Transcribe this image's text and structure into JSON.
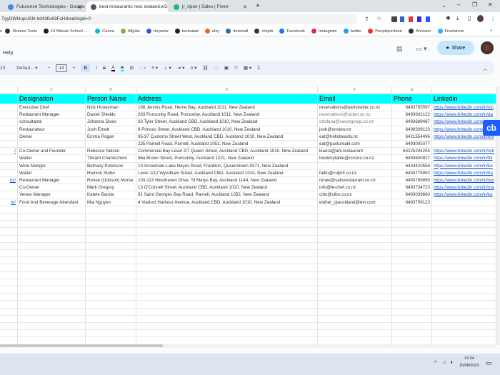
{
  "browser": {
    "tabs": [
      {
        "title": "Futurense Technologies - Google",
        "favicon_color": "#4285f4"
      },
      {
        "title": "best restaurants new zealand - G",
        "favicon_color": "#555555",
        "active": true
      },
      {
        "title": "jr_ripon | Sales | Fiverr",
        "favicon_color": "#1dbf73"
      }
    ],
    "new_tab": "+",
    "url": "TgyDWNupUSN-lrd43fix83FcH8/edit#gid=0",
    "bookmarks": [
      {
        "label": "Shanes Tools",
        "color": "#333"
      },
      {
        "label": "10 Minute School -...",
        "color": "#222"
      },
      {
        "label": "Canva",
        "color": "#00c4cc"
      },
      {
        "label": "Alljobs",
        "color": "#7cb342"
      },
      {
        "label": "tinywow",
        "color": "#3b5bdb"
      },
      {
        "label": "toolsalad",
        "color": "#222"
      },
      {
        "label": "etsy",
        "color": "#f1641e"
      },
      {
        "label": "timewall",
        "color": "#2b6cb0"
      },
      {
        "label": "clixjob",
        "color": "#333"
      },
      {
        "label": "Facebook",
        "color": "#1877f2"
      },
      {
        "label": "Instagram",
        "color": "#d62976"
      },
      {
        "label": "twitter",
        "color": "#1da1f2"
      },
      {
        "label": "Peopleperhour",
        "color": "#e53935"
      },
      {
        "label": "Amzaon",
        "color": "#333"
      },
      {
        "label": "Freelancer",
        "color": "#29b2fe"
      }
    ],
    "more": "»"
  },
  "sheets": {
    "menu_help": "Help",
    "share_label": "Share",
    "toolbar": {
      "zoom_partial": "23",
      "font": "Defaul...",
      "font_size": "14",
      "minus": "−",
      "plus": "+",
      "bold": "B",
      "italic": "I",
      "strike": "S",
      "text_color": "A",
      "sigma": "Σ",
      "link": "⛓"
    },
    "columns": [
      "C",
      "D",
      "E",
      "F",
      "G"
    ],
    "headers": [
      "Designation",
      "Person Name",
      "Address",
      "Email",
      "Phone",
      "Linkedin"
    ],
    "header_bg": "#00ffff",
    "rows": [
      {
        "b": "",
        "designation": "Executive Chef",
        "name": "Nick Honeyman",
        "address": "166 Jervois Road, Herne Bay, Auckland 1011, New Zealand",
        "email": "reservations@parisbutter.co.nz",
        "phone": "6493765597",
        "linkedin": "https://www.linkedin.com/in/nic"
      },
      {
        "b": "",
        "designation": "Restaurant Manager",
        "name": "Daniel Shields",
        "address": "283 Ponsonby Road, Ponsonby, Auckland 1011, New Zealand",
        "email": "reservations@sidart.co.nz",
        "phone": "6493602122",
        "linkedin": "https://www.linkedin.com/in/da"
      },
      {
        "b": "",
        "designation": "consultante",
        "name": "Johanna Dives",
        "address": "33 Tyler Street, Auckland CBD, Auckland 1010, New Zealand",
        "email": "ortolana@savorgroup.co.nz",
        "phone": "6493689487",
        "linkedin": "https://www.linkedin.com/in/jo"
      },
      {
        "b": "",
        "designation": "Restaurateur",
        "name": "Josh Emett",
        "address": "9 Princes Street, Auckland CBD, Auckland 1010, New Zealand",
        "email": "josh@onslow.nz",
        "phone": "6499309123",
        "linkedin": "https://www.linkedin.com/in/jo"
      },
      {
        "b": "",
        "designation": "Owner",
        "name": "Emma Rogan",
        "address": "95-97 Customs Street West, Auckland CBD, Auckland 1010, New Zealand",
        "email": "eat@hellobeasty.nz",
        "phone": "6421554496",
        "linkedin": "https://www.linkedin.com/in/em"
      },
      {
        "b": "",
        "designation": "",
        "name": "",
        "address": "235 Parnell Road, Parnell, Auckland 1052, New Zealand",
        "email": "eat@pastureakl.com",
        "phone": "6493005077",
        "linkedin": ""
      },
      {
        "b": "/",
        "designation": "Co-Owner and Founder",
        "name": "Rebecca Nelson",
        "address": "Commercial Bay Level 2/7 Queen Street, Auckland CBD, Auckland 1010, New Zealand",
        "email": "kiaora@ahi.restaurant",
        "phone": "64225244255",
        "linkedin": "https://www.linkedin.com/in/reb"
      },
      {
        "b": "",
        "designation": "Waiter",
        "name": "Thirarit Chantschool",
        "address": "56a Brown Street, Ponsonby, Auckland 1021, New Zealand",
        "email": "bookmytable@cocoro.co.nz",
        "phone": "6493600927",
        "linkedin": "https://www.linkedin.com/in/thi"
      },
      {
        "b": "",
        "designation": "Wine Manger",
        "name": "Bethany Robinson",
        "address": "10 Arrowtown-Lake Hayes Road, Frankton, Queenstown 9371, New Zealand",
        "email": "",
        "phone": "6434420556",
        "linkedin": "https://www.linkedin.com/in/be"
      },
      {
        "b": "",
        "designation": "Waiter",
        "name": "Hamish Stobo",
        "address": "Level 1/12 Wyndham Street, Auckland CBD, Auckland 1010, New Zealand",
        "email": "hello@culprit.co.nz",
        "phone": "6493775992",
        "linkedin": "https://www.linkedin.com/in/ha"
      },
      {
        "b": "nz/",
        "designation": "Restaurant Manager",
        "name": "Renee (Dobson) Morse",
        "address": "103-113 Westhaven Drive, St Marys Bay, Auckland 1144, New Zealand",
        "email": "renee@sailsrestaurant.co.nz",
        "phone": "6493789890",
        "linkedin": "https://www.linkedin.com/in/ren"
      },
      {
        "b": "",
        "designation": "Co-Owner",
        "name": "Mark Gregory",
        "address": "13 O'Connell Street, Auckland CBD, Auckland 1010, New Zealand",
        "email": "info@le-chef.co.nz",
        "phone": "6493734723",
        "linkedin": "https://www.linkedin.com/in/ma"
      },
      {
        "b": "",
        "designation": "Venue Manager",
        "name": "Katete Banda",
        "address": "91 Saint Georges Bay Road, Parnell, Auckland 1052, New Zealand",
        "email": "cibo@cibo.co.nz",
        "phone": "6493039660",
        "linkedin": "https://www.linkedin.com/in/ka"
      },
      {
        "b": "m/",
        "designation": "Food And Beverage Attendant",
        "name": "Mia Nguyen",
        "address": "4 Viaduct Harbour Avenue, Auckland CBD, Auckland 1010, New Zealand",
        "email": "esther_qtauckland@evt.com",
        "phone": "6493799123",
        "linkedin": ""
      }
    ]
  },
  "extension_badge": "cb",
  "taskbar": {
    "time": "14:34",
    "date": "15/08/2023"
  }
}
